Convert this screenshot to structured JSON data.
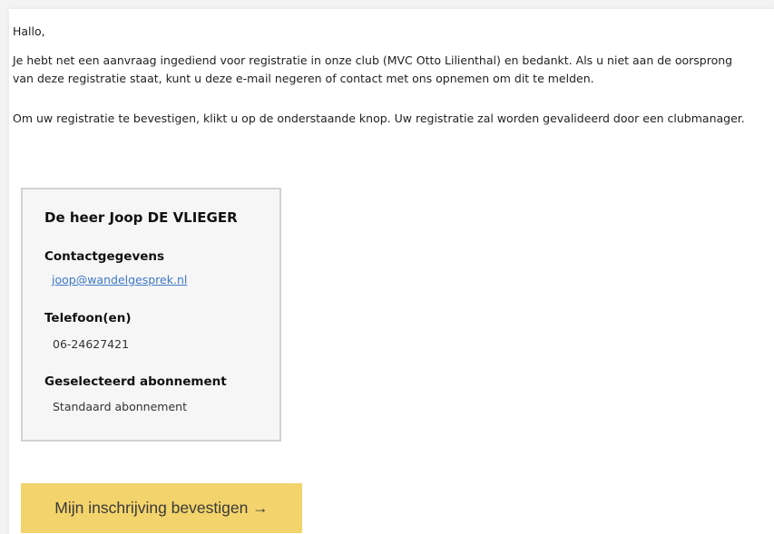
{
  "email": {
    "greeting": "Hallo,",
    "paragraph_1": "Je hebt net een aanvraag ingediend voor registratie in onze club (MVC Otto Lilienthal) en bedankt. Als u niet aan de oorsprong van deze registratie staat, kunt u deze e-mail negeren of contact met ons opnemen om dit te melden.",
    "paragraph_2": "Om uw registratie te bevestigen, klikt u op de onderstaande knop. Uw registratie zal worden gevalideerd door een clubmanager."
  },
  "card": {
    "name": "De heer Joop DE VLIEGER",
    "contact_heading": "Contactgegevens",
    "email": "joop@wandelgesprek.nl",
    "phone_heading": "Telefoon(en)",
    "phone": "06-24627421",
    "subscription_heading": "Geselecteerd abonnement",
    "subscription": "Standaard abonnement"
  },
  "button": {
    "label": "Mijn inschrijving bevestigen →"
  },
  "colors": {
    "button_bg": "#f3d36b",
    "link": "#3e78c7",
    "card_bg": "#f6f6f6",
    "card_border": "#d2d2d2"
  }
}
